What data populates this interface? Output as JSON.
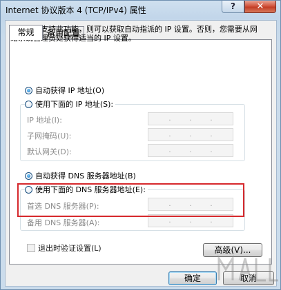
{
  "window": {
    "title": "Internet 协议版本 4 (TCP/IPv4) 属性",
    "help_label": "?",
    "close_label": "✕"
  },
  "tabs": [
    {
      "label": "常规",
      "active": true
    },
    {
      "label": "备用配置",
      "active": false
    }
  ],
  "description": "如果网络支持此功能，则可以获取自动指派的 IP 设置。否则，您需要从网络系统管理员处获得适当的 IP 设置。",
  "ip_section": {
    "auto_label": "自动获得 IP 地址(O)",
    "manual_label": "使用下面的 IP 地址(S):",
    "selected": "auto",
    "fields": [
      {
        "label": "IP 地址(I):",
        "value": ". . ."
      },
      {
        "label": "子网掩码(U):",
        "value": ". . ."
      },
      {
        "label": "默认网关(D):",
        "value": ". . ."
      }
    ]
  },
  "dns_section": {
    "auto_label": "自动获得 DNS 服务器地址(B)",
    "manual_label": "使用下面的 DNS 服务器地址(E):",
    "selected": "auto",
    "fields": [
      {
        "label": "首选 DNS 服务器(P):",
        "value": ". . ."
      },
      {
        "label": "备用 DNS 服务器(A):",
        "value": ". . ."
      }
    ]
  },
  "validate_checkbox": {
    "label": "退出时验证设置(L)",
    "checked": false
  },
  "buttons": {
    "advanced": "高级(V)...",
    "ok": "确定",
    "cancel": "取消"
  },
  "colors": {
    "highlight_box": "#d6282c",
    "title_bar": "#c2d6ea",
    "close_button": "#c23d25"
  }
}
